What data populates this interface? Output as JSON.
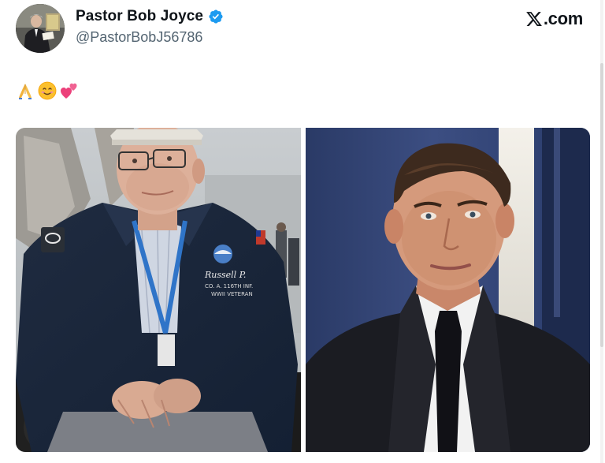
{
  "tweet": {
    "author": {
      "display_name": "Pastor Bob Joyce",
      "handle": "@PastorBobJ56786",
      "verified_icon": "verified-badge-icon",
      "avatar_icon": "avatar-photo"
    },
    "brand": {
      "text": ".com",
      "icon": "x-logo-icon"
    },
    "text_emojis": [
      "folded-hands-emoji",
      "smiling-face-emoji",
      "two-hearts-emoji"
    ],
    "media": [
      {
        "icon": "photo-elderly-veteran-in-wheelchair"
      },
      {
        "icon": "photo-man-in-dark-suit-portrait"
      }
    ]
  },
  "colors": {
    "name": "#0f1419",
    "handle": "#536471",
    "verified": "#1d9bf0"
  }
}
